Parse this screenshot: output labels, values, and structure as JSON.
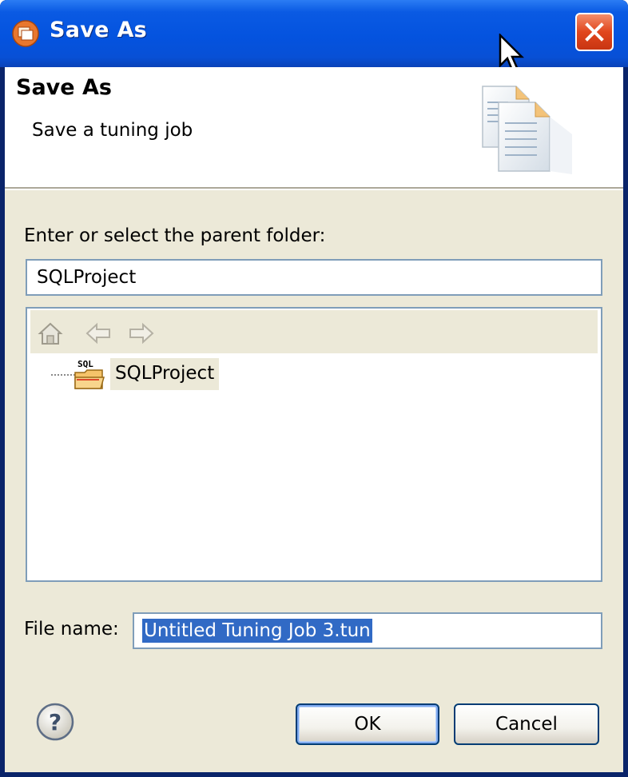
{
  "window": {
    "title": "Save As",
    "close_icon": "close-icon",
    "app_icon": "eclipse-app-icon"
  },
  "banner": {
    "title": "Save As",
    "description": "Save a tuning job",
    "image_icon": "documents-icon"
  },
  "folder": {
    "prompt": "Enter or select the parent folder:",
    "value": "SQLProject"
  },
  "tree": {
    "toolbar": [
      {
        "name": "home-icon"
      },
      {
        "name": "back-arrow-icon"
      },
      {
        "name": "forward-arrow-icon"
      }
    ],
    "items": [
      {
        "label": "SQLProject",
        "icon": "sql-project-folder-icon"
      }
    ]
  },
  "filename": {
    "label": "File name:",
    "value": "Untitled Tuning Job 3.tun"
  },
  "buttons": {
    "help_icon": "help-icon",
    "ok": "OK",
    "cancel": "Cancel"
  },
  "colors": {
    "titlebar": "#0453df",
    "dialog_face": "#ece9d8",
    "selection": "#316ac5",
    "close_button": "#e1461d",
    "input_border": "#7f9db9"
  }
}
